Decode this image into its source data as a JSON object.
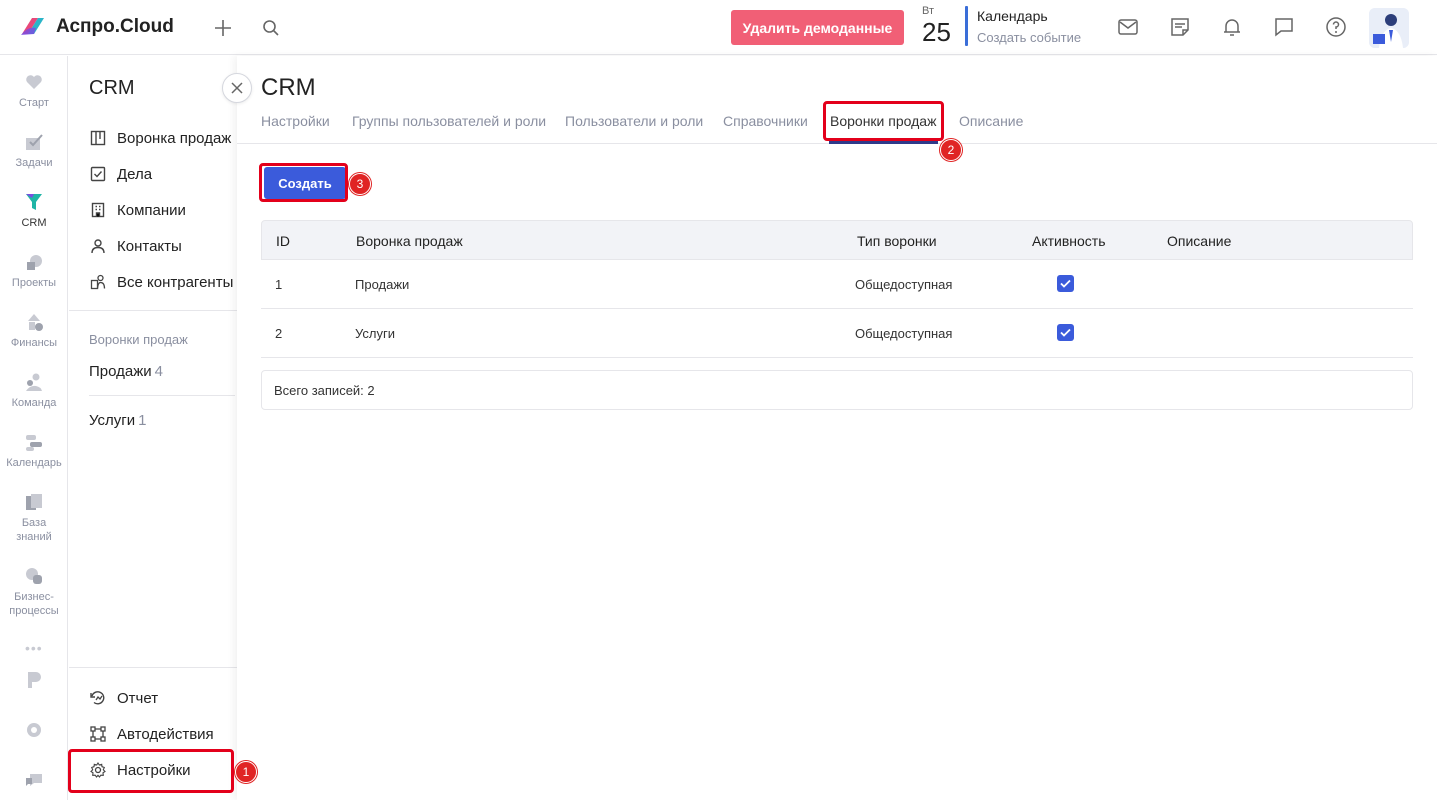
{
  "app": {
    "name": "Аспро.Cloud"
  },
  "topbar": {
    "demo_button": "Удалить демоданные",
    "date_day": "Вт",
    "date_num": "25",
    "calendar_title": "Календарь",
    "calendar_sub": "Создать событие"
  },
  "rail": {
    "items": [
      {
        "label": "Старт",
        "icon": "heart-icon"
      },
      {
        "label": "Задачи",
        "icon": "check-icon"
      },
      {
        "label": "CRM",
        "icon": "funnel-icon"
      },
      {
        "label": "Проекты",
        "icon": "projects-icon"
      },
      {
        "label": "Финансы",
        "icon": "finance-icon"
      },
      {
        "label": "Команда",
        "icon": "team-icon"
      },
      {
        "label": "Календарь",
        "icon": "calendar-icon"
      },
      {
        "label": "База знаний",
        "icon": "knowledge-icon"
      },
      {
        "label": "Бизнес-процессы",
        "icon": "process-icon"
      }
    ]
  },
  "sidemenu": {
    "title": "CRM",
    "items": [
      {
        "label": "Воронка продаж",
        "icon": "kanban-icon"
      },
      {
        "label": "Дела",
        "icon": "checklist-icon"
      },
      {
        "label": "Компании",
        "icon": "building-icon"
      },
      {
        "label": "Контакты",
        "icon": "person-icon"
      },
      {
        "label": "Все контрагенты",
        "icon": "people-icon"
      }
    ],
    "funnels_section": "Воронки продаж",
    "funnels": [
      {
        "label": "Продажи",
        "count": "4"
      },
      {
        "label": "Услуги",
        "count": "1"
      }
    ],
    "bottom": [
      {
        "label": "Отчет",
        "icon": "report-icon"
      },
      {
        "label": "Автодействия",
        "icon": "automation-icon"
      },
      {
        "label": "Настройки",
        "icon": "settings-icon"
      }
    ]
  },
  "main": {
    "title": "CRM",
    "tabs": [
      "Настройки",
      "Группы пользователей и роли",
      "Пользователи и роли",
      "Справочники",
      "Воронки продаж",
      "Описание"
    ],
    "active_tab": "Воронки продаж",
    "create_button": "Создать",
    "table": {
      "columns": [
        "ID",
        "Воронка продаж",
        "Тип воронки",
        "Активность",
        "Описание"
      ],
      "rows": [
        {
          "id": "1",
          "name": "Продажи",
          "type": "Общедоступная",
          "active": true,
          "description": ""
        },
        {
          "id": "2",
          "name": "Услуги",
          "type": "Общедоступная",
          "active": true,
          "description": ""
        }
      ]
    },
    "footer": "Всего записей: 2"
  },
  "annotations": {
    "badges": [
      "1",
      "2",
      "3"
    ],
    "color": "#e3001b"
  },
  "colors": {
    "accent": "#3b5bdb",
    "demo_button": "#f15f76",
    "highlight": "#e3001b"
  }
}
